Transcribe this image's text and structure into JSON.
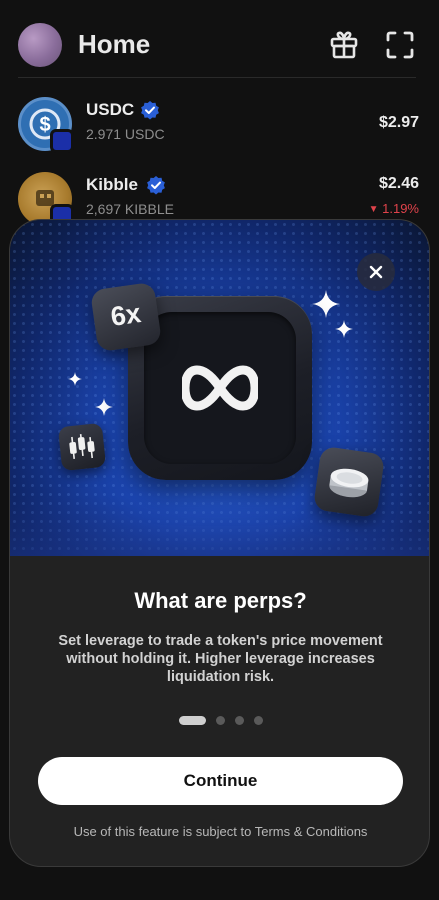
{
  "header": {
    "title": "Home"
  },
  "tokens": [
    {
      "name": "USDC",
      "amount": "2.971 USDC",
      "value": "$2.97",
      "change": ""
    },
    {
      "name": "Kibble",
      "amount": "2,697 KIBBLE",
      "value": "$2.46",
      "change": "1.19%"
    }
  ],
  "modal": {
    "badge_text": "6x",
    "title": "What are perps?",
    "description": "Set leverage to trade a token's price movement without holding it. Higher leverage increases liquidation risk.",
    "pager": {
      "total": 4,
      "current": 1
    },
    "continue_label": "Continue",
    "terms_text": "Use of this feature is subject to Terms & Conditions"
  },
  "colors": {
    "background": "#111111",
    "sheet": "#222222",
    "negative": "#e0434b",
    "verified": "#2a5fd6",
    "hero_blue": "#1c47b5"
  },
  "icons": [
    "gift-icon",
    "scan-icon",
    "verified-icon",
    "usdc-coin-icon",
    "kibble-coin-icon",
    "close-icon",
    "infinity-icon",
    "candlestick-icon",
    "coin-stack-icon",
    "sparkle-icon"
  ]
}
